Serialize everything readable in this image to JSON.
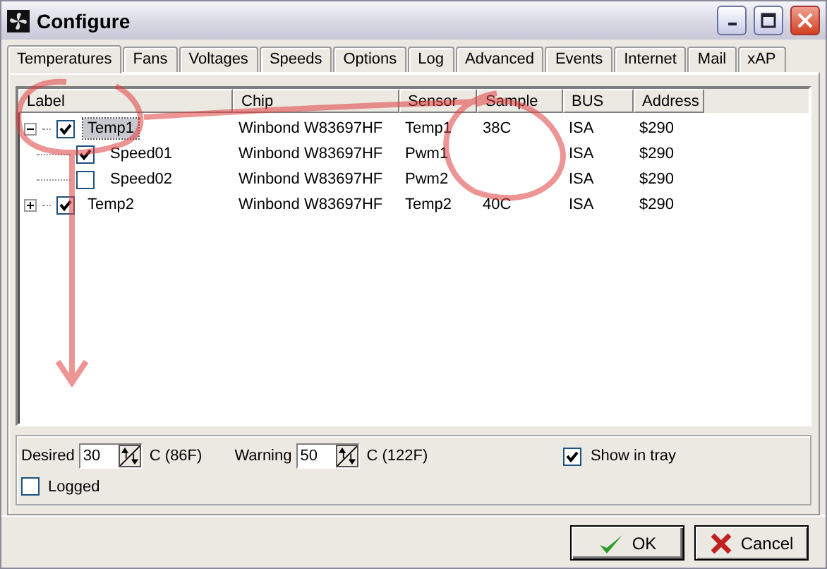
{
  "window": {
    "title": "Configure"
  },
  "tabs": [
    {
      "label": "Temperatures",
      "selected": true
    },
    {
      "label": "Fans",
      "selected": false
    },
    {
      "label": "Voltages",
      "selected": false
    },
    {
      "label": "Speeds",
      "selected": false
    },
    {
      "label": "Options",
      "selected": false
    },
    {
      "label": "Log",
      "selected": false
    },
    {
      "label": "Advanced",
      "selected": false
    },
    {
      "label": "Events",
      "selected": false
    },
    {
      "label": "Internet",
      "selected": false
    },
    {
      "label": "Mail",
      "selected": false
    },
    {
      "label": "xAP",
      "selected": false
    }
  ],
  "table": {
    "columns": [
      "Label",
      "Chip",
      "Sensor",
      "Sample",
      "BUS",
      "Address"
    ],
    "rows": [
      {
        "label": "Temp1",
        "checked": true,
        "expanded": true,
        "selected": true,
        "chip": "Winbond W83697HF",
        "sensor": "Temp1",
        "sample": "38C",
        "bus": "ISA",
        "address": "$290",
        "children": [
          {
            "label": "Speed01",
            "checked": true,
            "selected": false,
            "chip": "Winbond W83697HF",
            "sensor": "Pwm1",
            "bus": "ISA",
            "address": "$290"
          },
          {
            "label": "Speed02",
            "checked": false,
            "selected": false,
            "chip": "Winbond W83697HF",
            "sensor": "Pwm2",
            "bus": "ISA",
            "address": "$290"
          }
        ]
      },
      {
        "label": "Temp2",
        "checked": true,
        "expanded": false,
        "selected": false,
        "chip": "Winbond W83697HF",
        "sensor": "Temp2",
        "sample": "40C",
        "bus": "ISA",
        "address": "$290"
      }
    ]
  },
  "settings": {
    "spinners": [
      {
        "label": "Desired",
        "value": "30",
        "unit": "C (86F)"
      },
      {
        "label": "Warning",
        "value": "50",
        "unit": "C (122F)"
      }
    ],
    "show_in_tray": {
      "label": "Show in tray",
      "checked": true
    },
    "logged": {
      "label": "Logged",
      "checked": false
    }
  },
  "buttons": [
    {
      "kind": "ok",
      "label": "OK"
    },
    {
      "kind": "cancel",
      "label": "Cancel"
    }
  ]
}
